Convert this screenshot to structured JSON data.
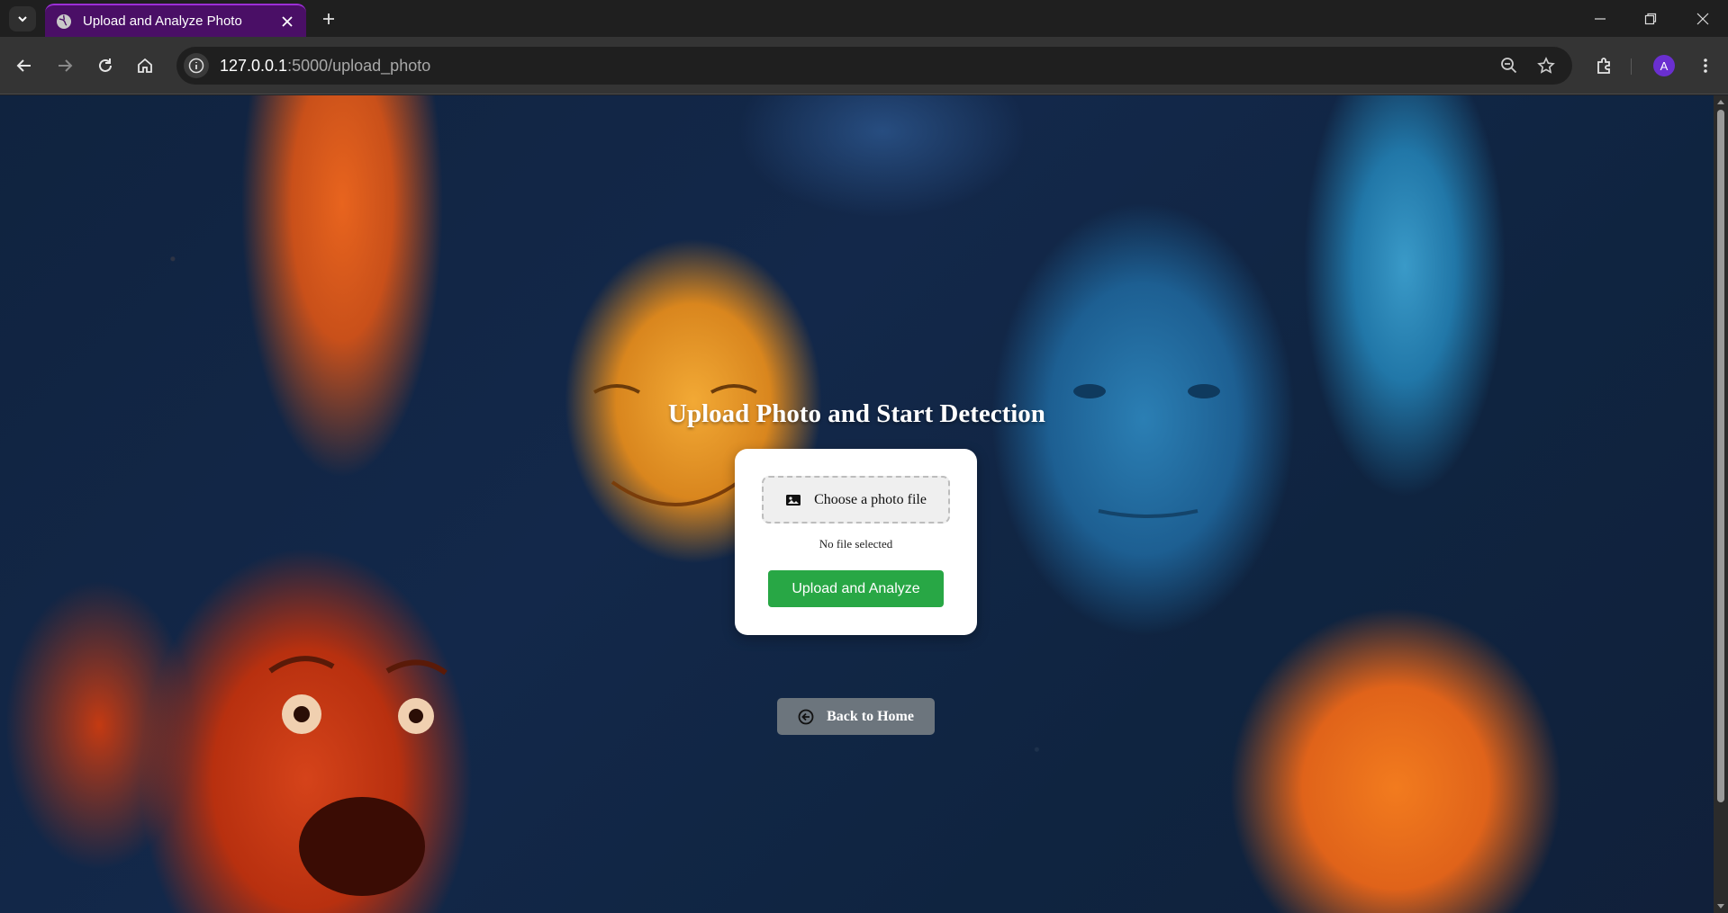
{
  "browser": {
    "tab_title": "Upload and Analyze Photo",
    "url_host": "127.0.0.1",
    "url_path": ":5000/upload_photo",
    "profile_initial": "A"
  },
  "page": {
    "heading": "Upload Photo and Start Detection",
    "choose_file_label": "Choose a photo file",
    "file_status": "No file selected",
    "upload_button": "Upload and Analyze",
    "back_button": "Back to Home"
  },
  "colors": {
    "tab_accent": "#4a0f66",
    "upload_button": "#28a745",
    "back_button": "#6c757d",
    "profile": "#6a2fd0"
  },
  "icons": {
    "tab_search": "chevron-down-icon",
    "favicon": "globe-icon",
    "tab_close": "close-icon",
    "new_tab": "plus-icon",
    "back": "arrow-left-icon",
    "forward": "arrow-right-icon",
    "reload": "reload-icon",
    "home": "home-icon",
    "site_info": "info-icon",
    "zoom": "zoom-out-icon",
    "bookmark": "star-icon",
    "extensions": "puzzle-icon",
    "menu": "kebab-menu-icon",
    "file_label": "image-icon",
    "back_to_home": "circle-arrow-left-icon"
  }
}
